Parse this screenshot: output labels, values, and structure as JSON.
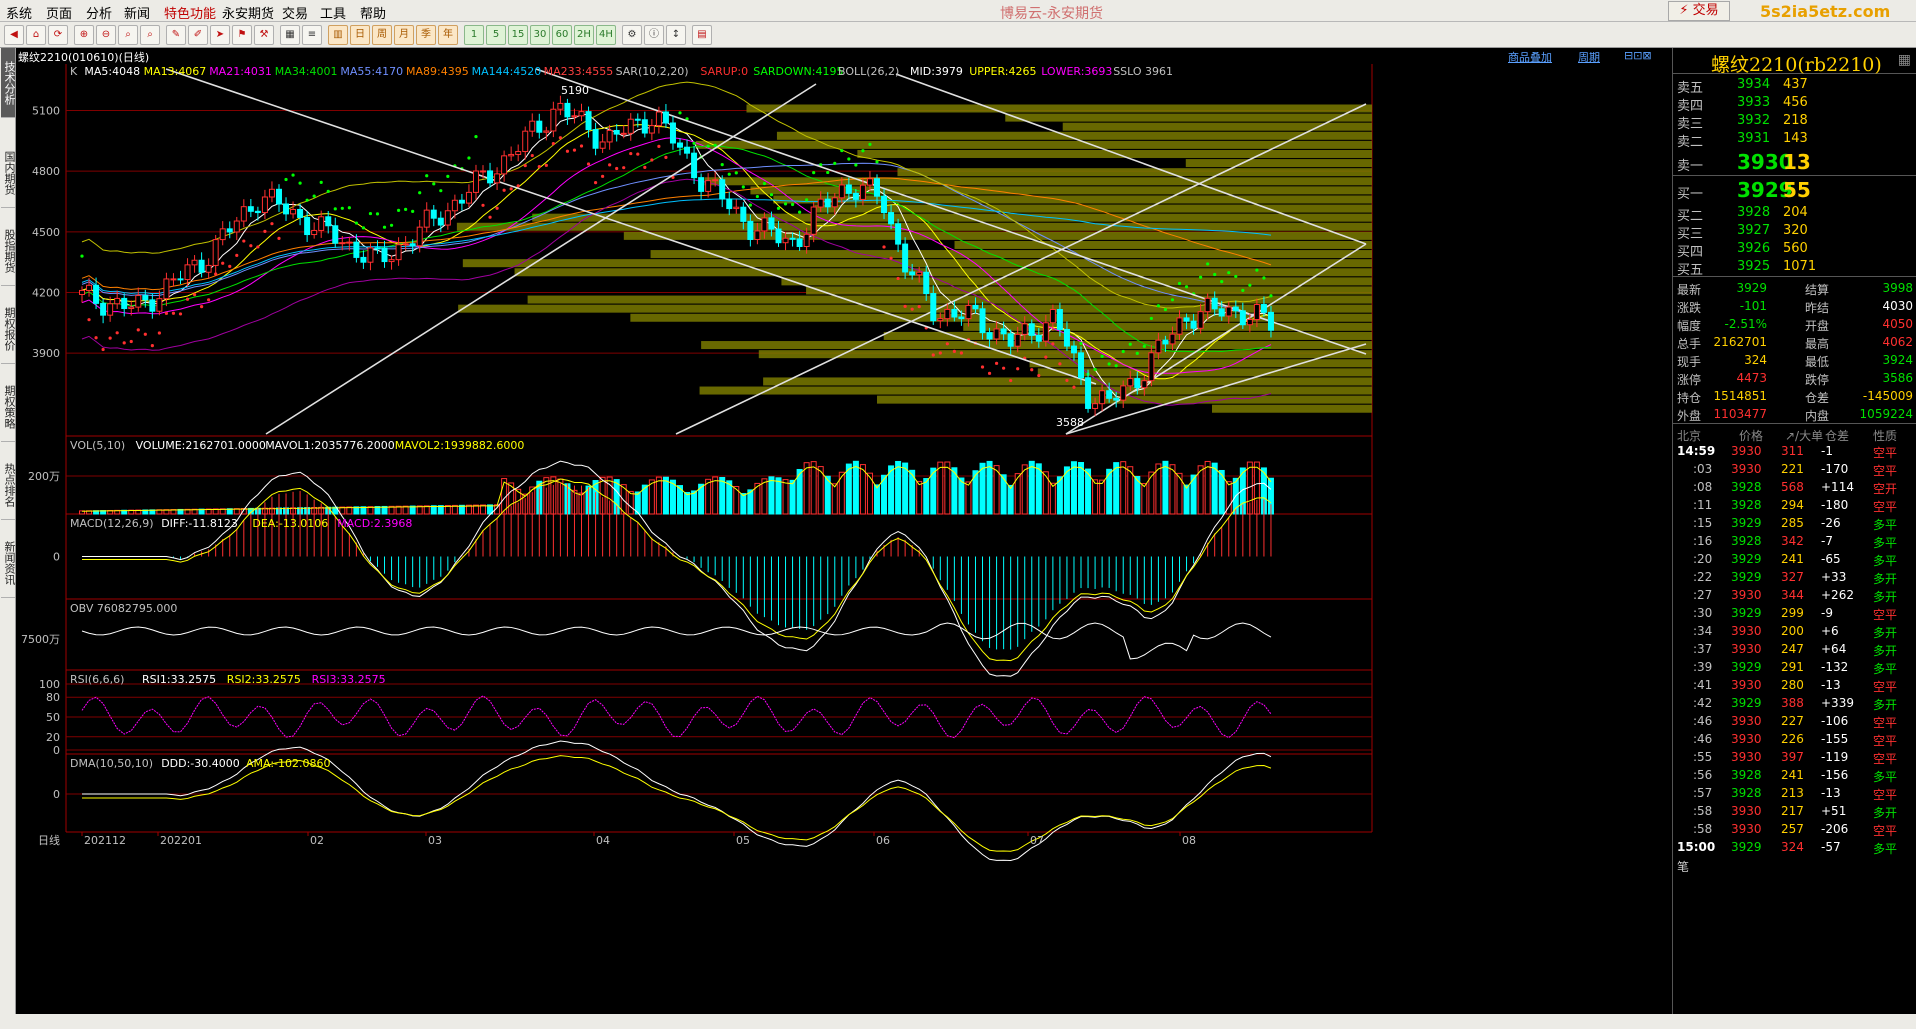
{
  "menu": {
    "items": [
      "系统",
      "页面",
      "分析",
      "新闻",
      "特色功能",
      "永安期货",
      "交易",
      "工具",
      "帮助"
    ],
    "active_index": 4,
    "app_title": "博易云-永安期货",
    "trade_button": "交易",
    "watermark": "5s2ia5etz.com"
  },
  "toolbar": {
    "period_buttons": [
      "1",
      "5",
      "15",
      "30",
      "60",
      "2H",
      "4H"
    ]
  },
  "left_tabs": [
    "技术分析",
    "国内期货",
    "股指期货",
    "期权报价",
    "期权策略",
    "热点排名",
    "新闻资讯"
  ],
  "chart_header": {
    "symbol": "螺纹2210(010610)(日线)",
    "link1": "商品叠加",
    "link2": "周期"
  },
  "main_legend": [
    {
      "text": "K",
      "color": "#c0c0c0"
    },
    {
      "text": "MA5:4048",
      "color": "#ffffff"
    },
    {
      "text": "MA13:4067",
      "color": "#ffff00"
    },
    {
      "text": "MA21:4031",
      "color": "#ff00ff"
    },
    {
      "text": "MA34:4001",
      "color": "#00e000"
    },
    {
      "text": "MA55:4170",
      "color": "#6f8fff"
    },
    {
      "text": "MA89:4395",
      "color": "#ff8000"
    },
    {
      "text": "MA144:4520",
      "color": "#00c0ff"
    },
    {
      "text": "MA233:4555",
      "color": "#ff4040"
    },
    {
      "text": "SAR(10,2,20)",
      "color": "#c0c0c0"
    },
    {
      "text": "SARUP:0",
      "color": "#ff3030"
    },
    {
      "text": "SARDOWN:4195",
      "color": "#00ff00"
    },
    {
      "text": "BOLL(26,2)",
      "color": "#c0c0c0"
    },
    {
      "text": "MID:3979",
      "color": "#ffffff"
    },
    {
      "text": "UPPER:4265",
      "color": "#ffff00"
    },
    {
      "text": "LOWER:3693",
      "color": "#ff00ff"
    },
    {
      "text": "SSLO 3961",
      "color": "#c0c0c0"
    }
  ],
  "price_axis": [
    "5100",
    "4800",
    "4500",
    "4200",
    "3900"
  ],
  "price_marks": {
    "high": "5190",
    "low": "3588"
  },
  "vol_panel": {
    "legend": [
      {
        "text": "VOL(5,10)",
        "color": "#c0c0c0"
      },
      {
        "text": "VOLUME:2162701.0000",
        "color": "#ffffff"
      },
      {
        "text": "MAVOL1:2035776.2000",
        "color": "#ffffff"
      },
      {
        "text": "MAVOL2:1939882.6000",
        "color": "#ffff00"
      }
    ],
    "axis": "200万"
  },
  "macd_panel": {
    "legend": [
      {
        "text": "MACD(12,26,9)",
        "color": "#c0c0c0"
      },
      {
        "text": "DIFF:-11.8123",
        "color": "#ffffff"
      },
      {
        "text": "DEA:-13.0106",
        "color": "#ffff00"
      },
      {
        "text": "MACD:2.3968",
        "color": "#ff00ff"
      }
    ],
    "axis": "0"
  },
  "obv_panel": {
    "legend": [
      {
        "text": "OBV 76082795.000",
        "color": "#c0c0c0"
      }
    ],
    "axis": "7500万"
  },
  "rsi_panel": {
    "legend": [
      {
        "text": "RSI(6,6,6)",
        "color": "#c0c0c0"
      },
      {
        "text": "RSI1:33.2575",
        "color": "#ffffff"
      },
      {
        "text": "RSI2:33.2575",
        "color": "#ffff00"
      },
      {
        "text": "RSI3:33.2575",
        "color": "#ff00ff"
      }
    ],
    "axis": [
      "100",
      "80",
      "50",
      "20",
      "0"
    ]
  },
  "dma_panel": {
    "legend": [
      {
        "text": "DMA(10,50,10)",
        "color": "#c0c0c0"
      },
      {
        "text": "DDD:-30.4000",
        "color": "#ffffff"
      },
      {
        "text": "AMA:-102.0860",
        "color": "#ffff00"
      }
    ],
    "axis": "0"
  },
  "time_axis": {
    "label": "日线",
    "ticks": [
      "202112",
      "202201",
      "02",
      "03",
      "04",
      "05",
      "06",
      "07",
      "08"
    ]
  },
  "quote": {
    "title": "螺纹2210(rb2210)",
    "asks": [
      {
        "label": "卖五",
        "price": "3934",
        "vol": "437"
      },
      {
        "label": "卖四",
        "price": "3933",
        "vol": "456"
      },
      {
        "label": "卖三",
        "price": "3932",
        "vol": "218"
      },
      {
        "label": "卖二",
        "price": "3931",
        "vol": "143"
      },
      {
        "label": "卖一",
        "price": "3930",
        "vol": "13"
      }
    ],
    "bids": [
      {
        "label": "买一",
        "price": "3929",
        "vol": "55"
      },
      {
        "label": "买二",
        "price": "3928",
        "vol": "204"
      },
      {
        "label": "买三",
        "price": "3927",
        "vol": "320"
      },
      {
        "label": "买四",
        "price": "3926",
        "vol": "560"
      },
      {
        "label": "买五",
        "price": "3925",
        "vol": "1071"
      }
    ],
    "stats": [
      {
        "l1": "最新",
        "v1": "3929",
        "c1": "#00e000",
        "l2": "结算",
        "v2": "3998",
        "c2": "#00e000"
      },
      {
        "l1": "涨跌",
        "v1": "-101",
        "c1": "#00e000",
        "l2": "昨结",
        "v2": "4030",
        "c2": "#ffffff"
      },
      {
        "l1": "幅度",
        "v1": "-2.51%",
        "c1": "#00e000",
        "l2": "开盘",
        "v2": "4050",
        "c2": "#ff3030"
      },
      {
        "l1": "总手",
        "v1": "2162701",
        "c1": "#ffd000",
        "l2": "最高",
        "v2": "4062",
        "c2": "#ff3030"
      },
      {
        "l1": "现手",
        "v1": "324",
        "c1": "#ffd000",
        "l2": "最低",
        "v2": "3924",
        "c2": "#00e000"
      },
      {
        "l1": "涨停",
        "v1": "4473",
        "c1": "#ff3030",
        "l2": "跌停",
        "v2": "3586",
        "c2": "#00e000"
      },
      {
        "l1": "持仓",
        "v1": "1514851",
        "c1": "#ffd000",
        "l2": "仓差",
        "v2": "-145009",
        "c2": "#ffd000"
      },
      {
        "l1": "外盘",
        "v1": "1103477",
        "c1": "#ff3030",
        "l2": "内盘",
        "v2": "1059224",
        "c2": "#00e000"
      }
    ],
    "ticks_header": {
      "c0": "北京",
      "c1": "价格",
      "c2": "↗/大单",
      "c3": "仓差",
      "c4": "性质"
    },
    "ticks": [
      {
        "t": "14:59",
        "p": "3930",
        "v": "311",
        "d": "-1",
        "n": "空平"
      },
      {
        "t": ":03",
        "p": "3930",
        "v": "221",
        "d": "-170",
        "n": "空平"
      },
      {
        "t": ":08",
        "p": "3928",
        "v": "568",
        "d": "+114",
        "n": "空开"
      },
      {
        "t": ":11",
        "p": "3928",
        "v": "294",
        "d": "-180",
        "n": "空平"
      },
      {
        "t": ":15",
        "p": "3929",
        "v": "285",
        "d": "-26",
        "n": "多平"
      },
      {
        "t": ":16",
        "p": "3928",
        "v": "342",
        "d": "-7",
        "n": "多平"
      },
      {
        "t": ":20",
        "p": "3929",
        "v": "241",
        "d": "-65",
        "n": "多平"
      },
      {
        "t": ":22",
        "p": "3929",
        "v": "327",
        "d": "+33",
        "n": "多开"
      },
      {
        "t": ":27",
        "p": "3930",
        "v": "344",
        "d": "+262",
        "n": "多开"
      },
      {
        "t": ":30",
        "p": "3929",
        "v": "299",
        "d": "-9",
        "n": "空平"
      },
      {
        "t": ":34",
        "p": "3930",
        "v": "200",
        "d": "+6",
        "n": "多开"
      },
      {
        "t": ":37",
        "p": "3930",
        "v": "247",
        "d": "+64",
        "n": "多开"
      },
      {
        "t": ":39",
        "p": "3929",
        "v": "291",
        "d": "-132",
        "n": "多平"
      },
      {
        "t": ":41",
        "p": "3930",
        "v": "280",
        "d": "-13",
        "n": "空平"
      },
      {
        "t": ":42",
        "p": "3929",
        "v": "388",
        "d": "+339",
        "n": "多开"
      },
      {
        "t": ":46",
        "p": "3930",
        "v": "227",
        "d": "-106",
        "n": "空平"
      },
      {
        "t": ":46",
        "p": "3930",
        "v": "226",
        "d": "-155",
        "n": "空平"
      },
      {
        "t": ":55",
        "p": "3930",
        "v": "397",
        "d": "-119",
        "n": "空平"
      },
      {
        "t": ":56",
        "p": "3928",
        "v": "241",
        "d": "-156",
        "n": "多平"
      },
      {
        "t": ":57",
        "p": "3928",
        "v": "213",
        "d": "-13",
        "n": "空平"
      },
      {
        "t": ":58",
        "p": "3930",
        "v": "217",
        "d": "+51",
        "n": "多开"
      },
      {
        "t": ":58",
        "p": "3930",
        "v": "257",
        "d": "-206",
        "n": "空平"
      },
      {
        "t": "15:00",
        "p": "3929",
        "v": "324",
        "d": "-57",
        "n": "多平"
      }
    ],
    "bottom_label": "笔"
  },
  "colors": {
    "up": "#ff3030",
    "down": "#00ffff",
    "grid": "#800000",
    "volume_profile": "#7a7a00"
  }
}
